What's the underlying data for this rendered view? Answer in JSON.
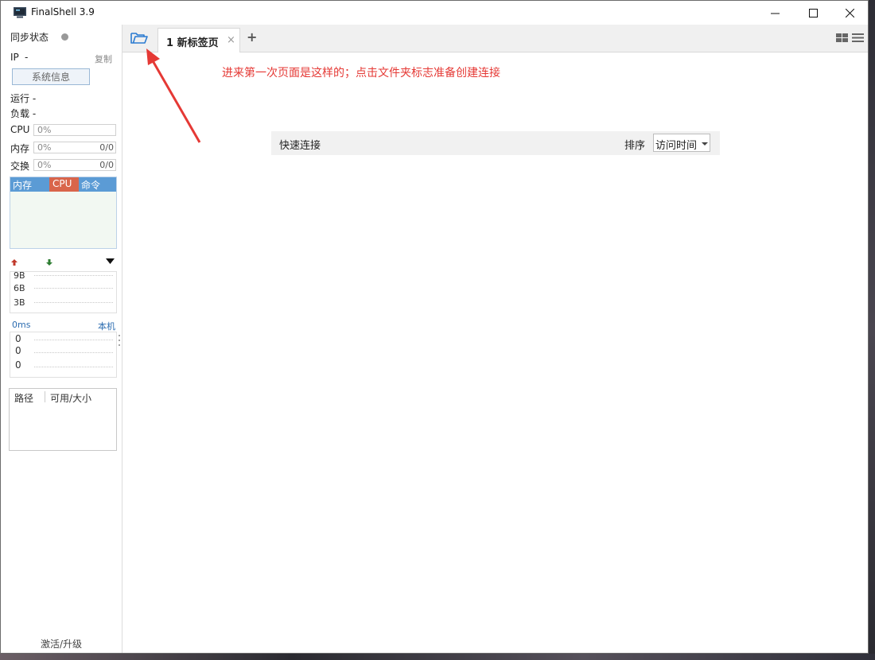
{
  "window": {
    "title": "FinalShell 3.9"
  },
  "sidebar": {
    "sync_label": "同步状态",
    "ip_label": "IP",
    "ip_value": "-",
    "copy_label": "复制",
    "sysinfo_button": "系统信息",
    "run_label": "运行 -",
    "load_label": "负载 -",
    "cpu": {
      "label": "CPU",
      "percent": "0%"
    },
    "memory": {
      "label": "内存",
      "percent": "0%",
      "count": "0/0"
    },
    "swap": {
      "label": "交换",
      "percent": "0%",
      "count": "0/0"
    },
    "process_tabs": [
      "内存",
      "CPU",
      "命令"
    ],
    "network_levels": [
      "9B",
      "6B",
      "3B"
    ],
    "ping": {
      "latency": "0ms",
      "host": "本机",
      "values": [
        "0",
        "0",
        "0"
      ]
    },
    "disk_headers": [
      "路径",
      "可用/大小"
    ],
    "activate_label": "激活/升级"
  },
  "tabs": [
    {
      "label": "1 新标签页"
    }
  ],
  "annotation_text": "进来第一次页面是这样的；点击文件夹标志准备创建连接",
  "quick_connect": {
    "title": "快速连接",
    "sort_label": "排序",
    "sort_value": "访问时间"
  },
  "colors": {
    "accent_blue": "#5b9bd5",
    "cpu_tab": "#d9654b",
    "annotation": "#e53935",
    "folder_icon": "#2b7bd1"
  }
}
